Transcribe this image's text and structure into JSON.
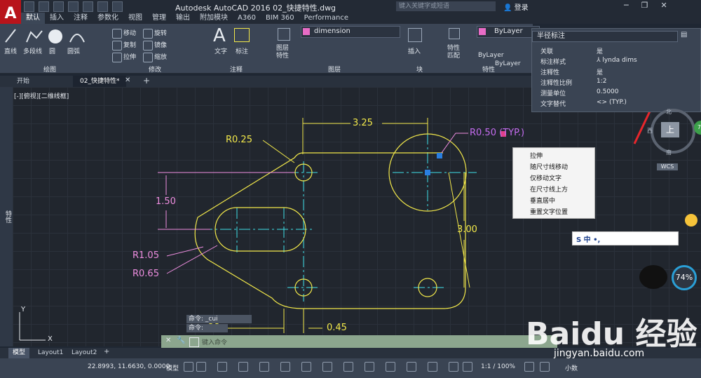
{
  "app": {
    "title": "Autodesk AutoCAD 2016    02_快捷特性.dwg",
    "logo_letter": "A",
    "search_placeholder": "键入关键字或短语",
    "login": "登录"
  },
  "ribbon_tabs": [
    "默认",
    "插入",
    "注释",
    "参数化",
    "视图",
    "管理",
    "输出",
    "附加模块",
    "A360",
    "BIM 360",
    "Performance"
  ],
  "ribbon": {
    "draw": {
      "label": "绘图",
      "line": "直线",
      "polyline": "多段线",
      "circle": "圆",
      "arc": "圆弧"
    },
    "modify": {
      "label": "修改",
      "move": "移动",
      "rotate": "旋转",
      "copy": "复制",
      "mirror": "镜像",
      "stretch": "拉伸",
      "scale": "缩放"
    },
    "annotate": {
      "label": "注释",
      "text": "文字",
      "dimension": "标注"
    },
    "layers": {
      "label": "图层",
      "properties": "图层\n特性",
      "current_layer": "dimension"
    },
    "block": {
      "label": "块",
      "insert": "插入"
    },
    "properties": {
      "label": "特性",
      "match": "特性\n匹配",
      "color": "ByLayer",
      "linetype": "ByLayer",
      "lineweight": "ByLayer"
    }
  },
  "doc_tabs": [
    "开始",
    "02_快捷特性*"
  ],
  "viewport_label": "[-][俯视][二维线框]",
  "quick_properties": {
    "header": "半径标注",
    "rows": [
      {
        "key": "关联",
        "value": "是"
      },
      {
        "key": "标注样式",
        "value": "lynda dims"
      },
      {
        "key": "注释性",
        "value": "是"
      },
      {
        "key": "注释性比例",
        "value": "1:2"
      },
      {
        "key": "测量单位",
        "value": "0.5000"
      },
      {
        "key": "文字替代",
        "value": "<> (TYP.)"
      }
    ]
  },
  "context_menu": [
    "拉伸",
    "随尺寸线移动",
    "仅移动文字",
    "在尺寸线上方",
    "垂直居中",
    "重置文字位置"
  ],
  "drawing": {
    "dim_top": "3.25",
    "r025": "R0.25",
    "r050": "R0.50 (TYP.)",
    "dim_left": "1.50",
    "dim_right": "3.00",
    "r105": "R1.05",
    "r065": "R0.65",
    "dim_bottom": "0.45",
    "dim_bottom_left": "28",
    "ucs_x": "X",
    "ucs_y": "Y"
  },
  "command": {
    "line1": "命令: _cui",
    "line2": "命令:",
    "prompt": "键入命令"
  },
  "model_tabs": [
    "模型",
    "Layout1",
    "Layout2"
  ],
  "status": {
    "coords": "22.8993, 11.6630, 0.0000",
    "model": "模型",
    "scale": "1:1 / 100%",
    "units": "小数"
  },
  "viewcube": {
    "top": "上",
    "north": "北",
    "south": "南",
    "west": "西",
    "wcs": "WCS"
  },
  "badges": {
    "pct_small": "74",
    "pct_big": "74%"
  },
  "props_side": "特性",
  "ime": {
    "label": "S 中 •,"
  },
  "watermark": {
    "brand": "Baidu 经验",
    "site": "jingyan.baidu.com"
  },
  "colors": {
    "accent_red": "#e8262c",
    "dim_yellow": "#f2e84a",
    "dim_pink": "#ee8ee0",
    "cyan": "#3ee0e8",
    "magenta_label": "#c56cf0"
  }
}
